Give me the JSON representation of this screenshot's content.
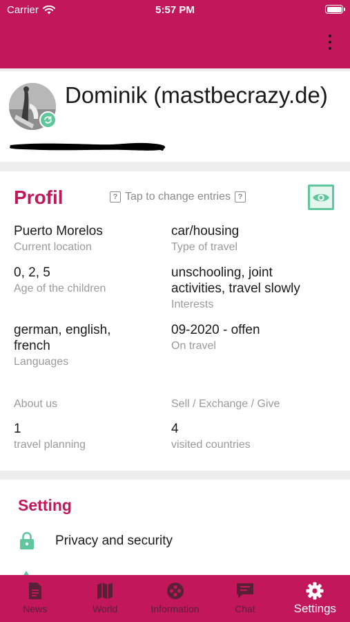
{
  "status_bar": {
    "carrier": "Carrier",
    "time": "5:57 PM"
  },
  "user": {
    "name": "Dominik (mastbecrazy.de)"
  },
  "profile": {
    "title": "Profil",
    "hint": "Tap to change entries",
    "fields": [
      {
        "value": "Puerto Morelos",
        "label": "Current location"
      },
      {
        "value": "car/housing",
        "label": "Type of travel"
      },
      {
        "value": "0, 2, 5",
        "label": "Age of the children"
      },
      {
        "value": "unschooling, joint activities, travel slowly",
        "label": "Interests"
      },
      {
        "value": "german, english, french",
        "label": "Languages"
      },
      {
        "value": "09-2020 - offen",
        "label": "On travel"
      }
    ],
    "about_label": "About us",
    "sell_label": "Sell / Exchange / Give",
    "stats": [
      {
        "value": "1",
        "label": "travel planning"
      },
      {
        "value": "4",
        "label": "visited countries"
      }
    ]
  },
  "setting": {
    "title": "Setting",
    "items": [
      {
        "label": "Privacy and security",
        "icon": "lock-icon"
      }
    ]
  },
  "tabs": [
    {
      "label": "News",
      "icon": "document-icon"
    },
    {
      "label": "World",
      "icon": "map-icon"
    },
    {
      "label": "Information",
      "icon": "info-circle-icon"
    },
    {
      "label": "Chat",
      "icon": "chat-icon"
    },
    {
      "label": "Settings",
      "icon": "gear-icon",
      "active": true
    }
  ],
  "colors": {
    "brand": "#c2185b",
    "accent": "#5fc79b",
    "tab_inactive": "#5a2035"
  }
}
